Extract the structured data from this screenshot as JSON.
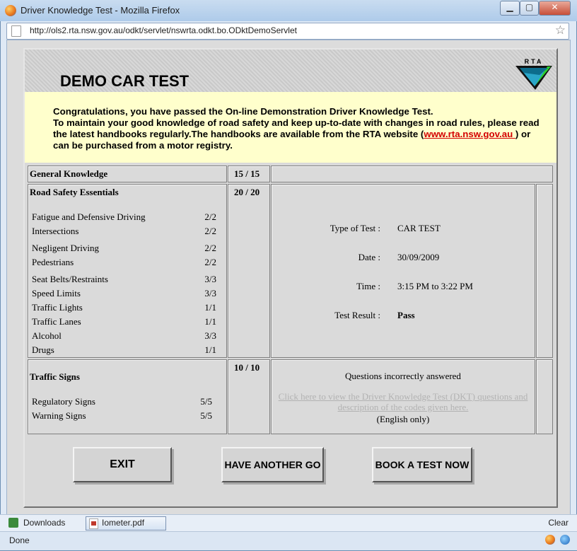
{
  "window": {
    "title": "Driver Knowledge Test - Mozilla Firefox",
    "minimize": "▁",
    "maximize": "▢",
    "close": "✕"
  },
  "url": "http://ols2.rta.nsw.gov.au/odkt/servlet/nswrta.odkt.bo.ODktDemoServlet",
  "page": {
    "title": "DEMO CAR TEST",
    "logo_text": "RTA",
    "message": {
      "line1": "Congratulations, you have passed the On-line Demonstration Driver Knowledge Test.",
      "line2": "To maintain your good knowledge of road safety and keep up-to-date with changes in road rules, please read the latest handbooks regularly.The handbooks are available from the RTA website (",
      "link": "www.rta.nsw.gov.au ",
      "line3": ") or can be purchased from a motor registry."
    },
    "general_knowledge": {
      "label": "General Knowledge",
      "score": "15 / 15"
    },
    "road_safety": {
      "label": "Road Safety Essentials",
      "score": "20 / 20",
      "items": [
        {
          "name": "Fatigue and Defensive Driving",
          "score": "2/2"
        },
        {
          "name": "Intersections",
          "score": "2/2"
        },
        {
          "name": "Negligent Driving",
          "score": "2/2"
        },
        {
          "name": "Pedestrians",
          "score": "2/2"
        },
        {
          "name": "Seat Belts/Restraints",
          "score": "3/3"
        },
        {
          "name": "Speed Limits",
          "score": "3/3"
        },
        {
          "name": "Traffic Lights",
          "score": "1/1"
        },
        {
          "name": "Traffic Lanes",
          "score": "1/1"
        },
        {
          "name": "Alcohol",
          "score": "3/3"
        },
        {
          "name": "Drugs",
          "score": "1/1"
        }
      ]
    },
    "details": {
      "type_label": "Type of Test  :",
      "type_value": "CAR TEST",
      "date_label": "Date  :",
      "date_value": "30/09/2009",
      "time_label": "Time  :",
      "time_value": "3:15 PM to 3:22 PM",
      "result_label": "Test Result  :",
      "result_value": "Pass"
    },
    "traffic_signs": {
      "label": "Traffic Signs",
      "score": "10 / 10",
      "items": [
        {
          "name": "Regulatory Signs",
          "score": "5/5"
        },
        {
          "name": "Warning Signs",
          "score": "5/5"
        }
      ]
    },
    "questions": {
      "heading": "Questions incorrectly answered",
      "link": "Click here to view the Driver Knowledge Test (DKT) questions and description of the codes given here.",
      "note": "(English only)"
    },
    "buttons": {
      "exit": "EXIT",
      "again": "HAVE ANOTHER GO",
      "book": "BOOK A TEST NOW"
    }
  },
  "downloads": {
    "label": "Downloads",
    "file": "Iometer.pdf",
    "clear": "Clear"
  },
  "status": "Done",
  "icons": [
    "firefox-icon",
    "page-icon",
    "star-icon",
    "rta-logo",
    "downloads-icon",
    "pdf-icon"
  ]
}
